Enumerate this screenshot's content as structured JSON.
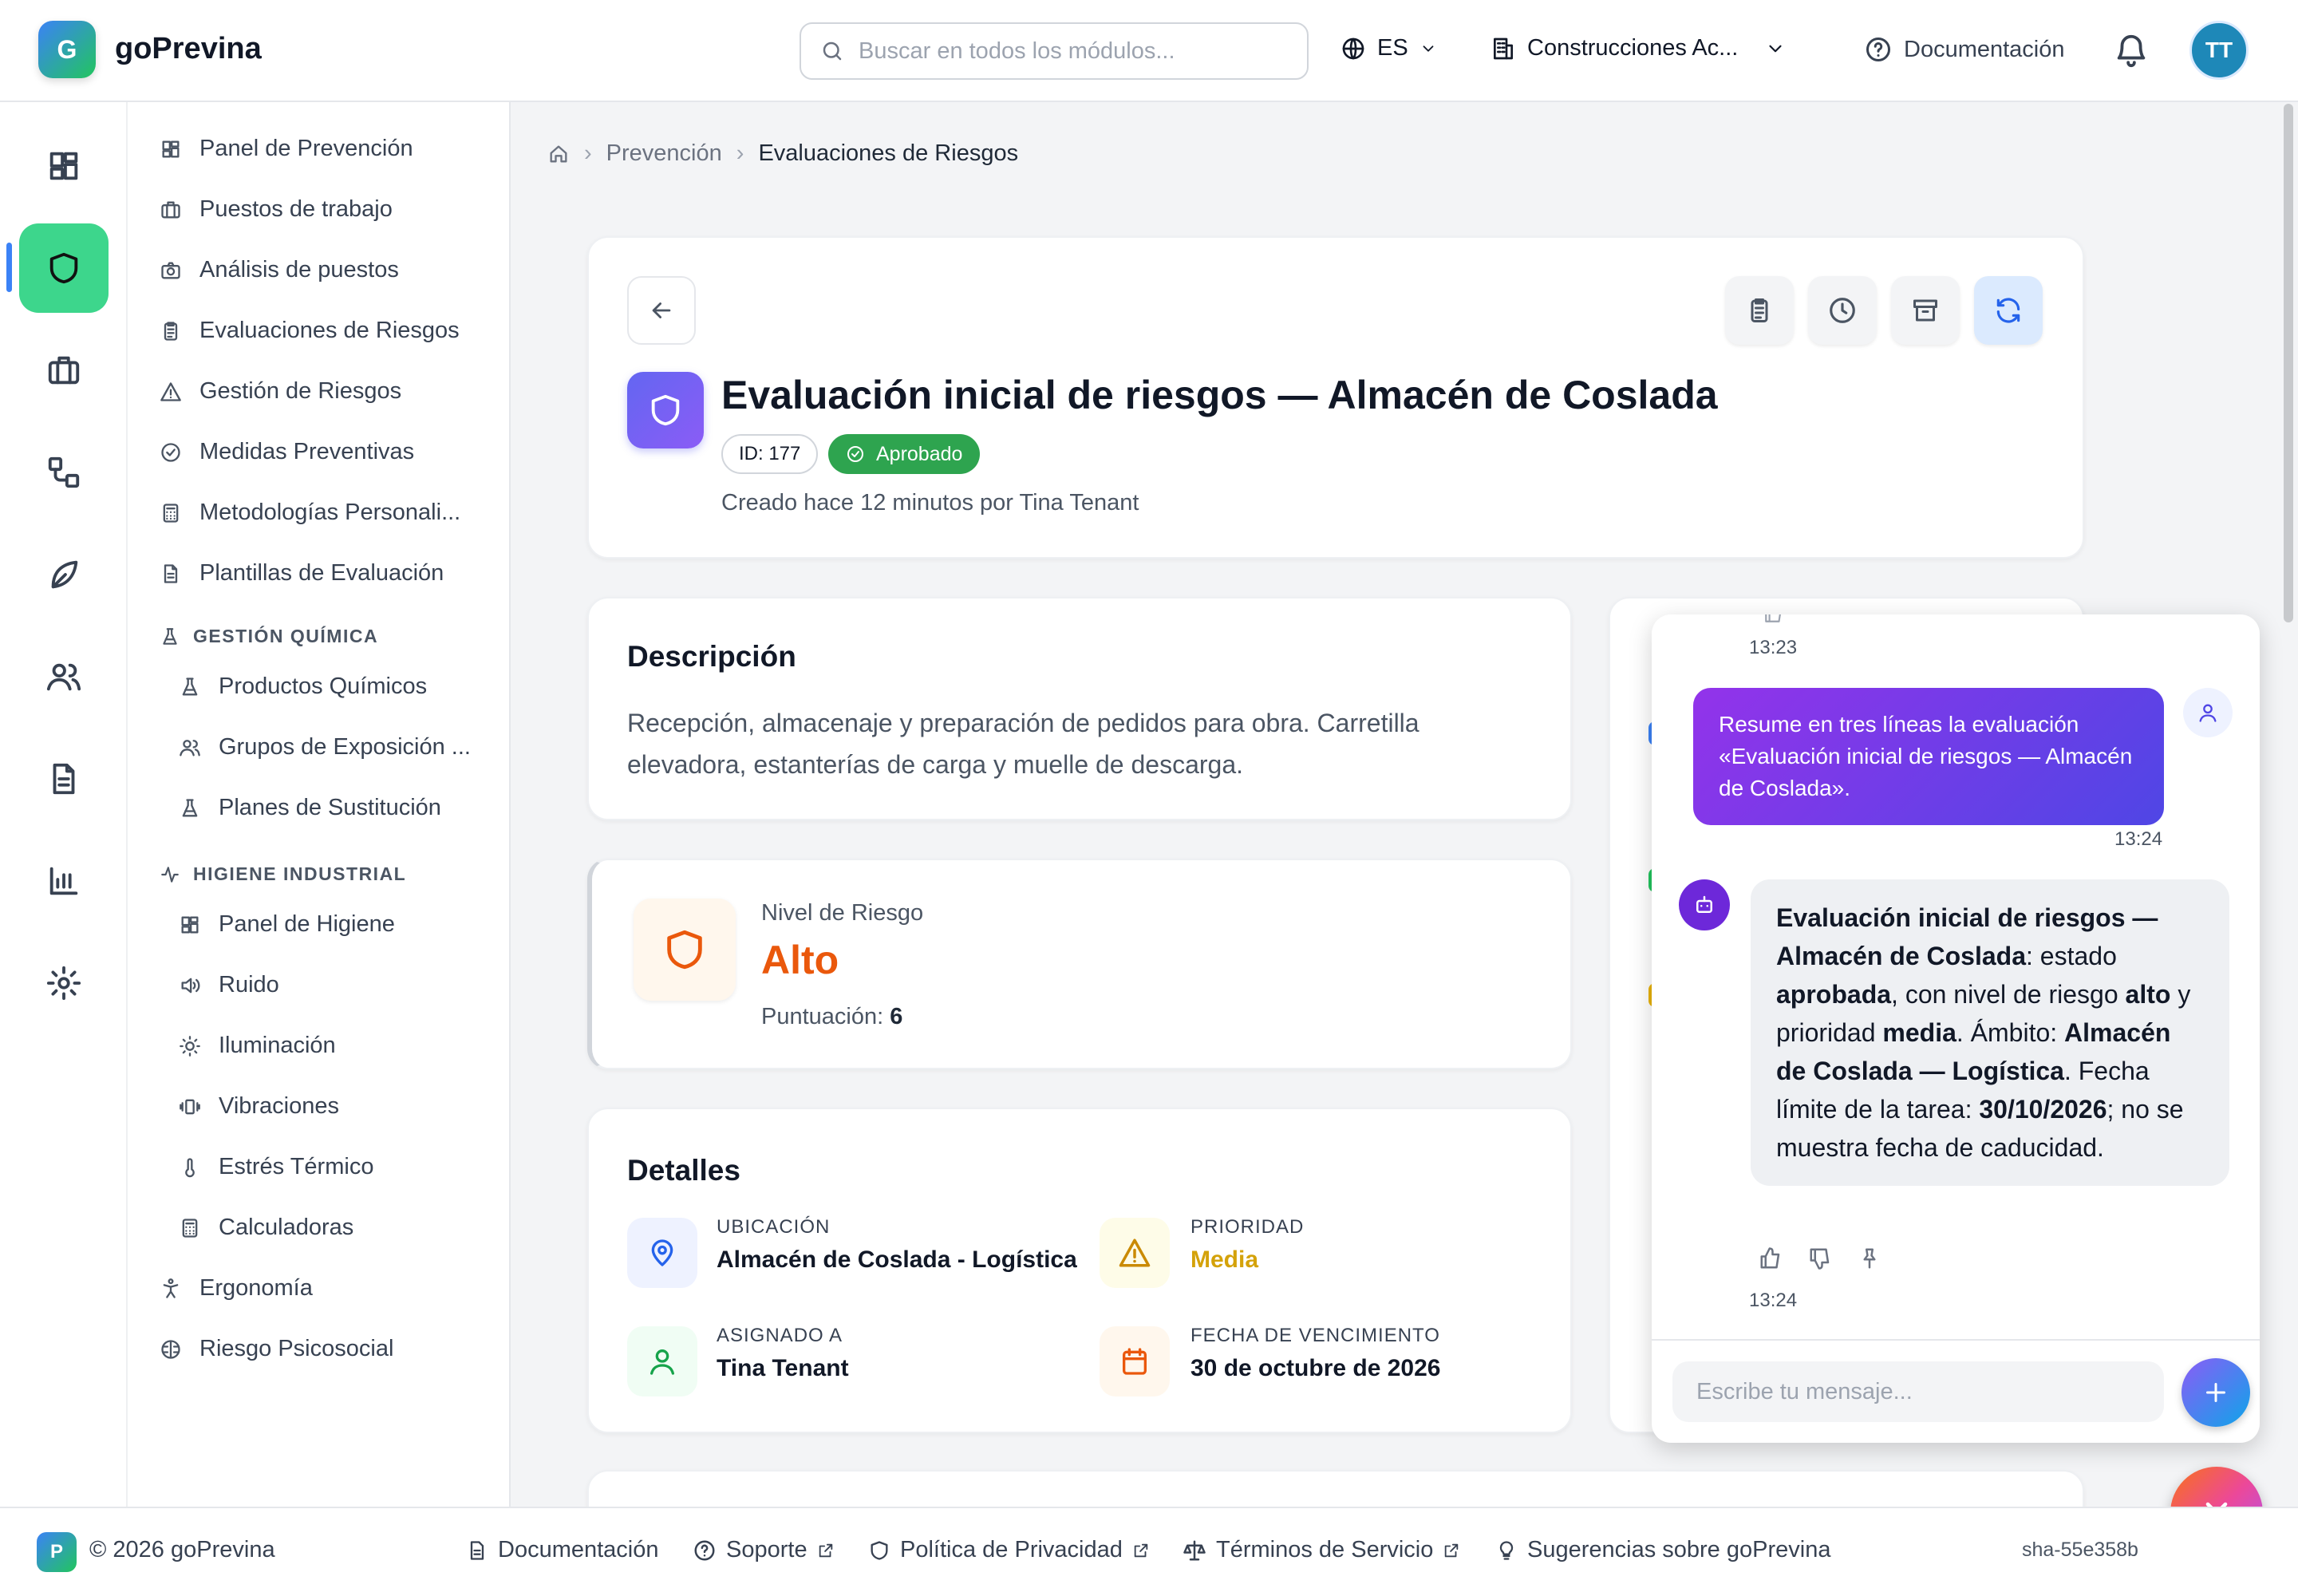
{
  "app": {
    "logo_letter": "G",
    "name": "goPrevina"
  },
  "header": {
    "search_placeholder": "Buscar en todos los módulos...",
    "language": "ES",
    "organization": "Construcciones Ac...",
    "docs_label": "Documentación",
    "avatar_initials": "TT"
  },
  "sidebar": {
    "items": [
      {
        "label": "Panel de Prevención",
        "icon": "dashboard-icon"
      },
      {
        "label": "Puestos de trabajo",
        "icon": "briefcase-icon"
      },
      {
        "label": "Análisis de puestos",
        "icon": "camera-icon"
      },
      {
        "label": "Evaluaciones de Riesgos",
        "icon": "clipboard-icon"
      },
      {
        "label": "Gestión de Riesgos",
        "icon": "warning-icon"
      },
      {
        "label": "Medidas Preventivas",
        "icon": "check-circle-icon"
      },
      {
        "label": "Metodologías Personali...",
        "icon": "calculator-icon"
      },
      {
        "label": "Plantillas de Evaluación",
        "icon": "document-icon"
      }
    ],
    "section_quimica": "GESTIÓN QUÍMICA",
    "quimica_items": [
      {
        "label": "Productos Químicos",
        "icon": "flask-icon"
      },
      {
        "label": "Grupos de Exposición ...",
        "icon": "users-icon"
      },
      {
        "label": "Planes de Sustitución",
        "icon": "flask-icon"
      }
    ],
    "section_higiene": "HIGIENE INDUSTRIAL",
    "higiene_items": [
      {
        "label": "Panel de Higiene",
        "icon": "dashboard-icon"
      },
      {
        "label": "Ruido",
        "icon": "speaker-icon"
      },
      {
        "label": "Iluminación",
        "icon": "sun-icon"
      },
      {
        "label": "Vibraciones",
        "icon": "vibration-icon"
      },
      {
        "label": "Estrés Térmico",
        "icon": "thermometer-icon"
      },
      {
        "label": "Calculadoras",
        "icon": "calculator-icon"
      }
    ],
    "bottom_items": [
      {
        "label": "Ergonomía",
        "icon": "person-icon"
      },
      {
        "label": "Riesgo Psicosocial",
        "icon": "brain-icon"
      }
    ]
  },
  "breadcrumb": {
    "items": [
      "Prevención",
      "Evaluaciones de Riesgos"
    ]
  },
  "evaluation": {
    "title": "Evaluación inicial de riesgos — Almacén de Coslada",
    "id_label": "ID: 177",
    "status": "Aprobado",
    "created": "Creado hace 12 minutos por Tina Tenant"
  },
  "description": {
    "heading": "Descripción",
    "text": "Recepción, almacenaje y preparación de pedidos para obra. Carretilla elevadora, estanterías de carga y muelle de descarga."
  },
  "risk": {
    "label": "Nivel de Riesgo",
    "level": "Alto",
    "score_label": "Puntuación:",
    "score": "6",
    "color": "#ea580c"
  },
  "details": {
    "heading": "Detalles",
    "location_label": "UBICACIÓN",
    "location": "Almacén de Coslada - Logística",
    "priority_label": "PRIORIDAD",
    "priority": "Media",
    "assigned_label": "ASIGNADO A",
    "assigned": "Tina Tenant",
    "due_label": "FECHA DE VENCIMIENTO",
    "due": "30 de octubre de 2026"
  },
  "chat": {
    "time_top": "13:23",
    "user_message": "Resume en tres líneas la evaluación «Evaluación inicial de riesgos — Almacén de Coslada».",
    "user_time": "13:24",
    "bot": {
      "p1": "Evaluación inicial de riesgos — Almacén de Coslada",
      "p2": ": estado ",
      "p3": "aprobada",
      "p4": ", con nivel de riesgo ",
      "p5": "alto",
      "p6": " y prioridad ",
      "p7": "media",
      "p8": ". Ámbito: ",
      "p9": "Almacén de Coslada — Logística",
      "p10": ". Fecha límite de la tarea: ",
      "p11": "30/10/2026",
      "p12": "; no se muestra fecha de caducidad."
    },
    "bot_time": "13:24",
    "input_placeholder": "Escribe tu mensaje..."
  },
  "footer": {
    "logo_letter": "P",
    "copyright": "© 2026 goPrevina",
    "links": [
      "Documentación",
      "Soporte",
      "Política de Privacidad",
      "Términos de Servicio",
      "Sugerencias sobre goPrevina"
    ],
    "version": "sha-55e358b"
  },
  "colors": {
    "accent_green": "#3dd68c",
    "status_green": "#2ea44f",
    "priority": "#d4a20a",
    "chat_gradient": [
      "#9333ea",
      "#4f46e5"
    ],
    "fab_gradient": [
      "#f97316",
      "#ec4899"
    ]
  }
}
